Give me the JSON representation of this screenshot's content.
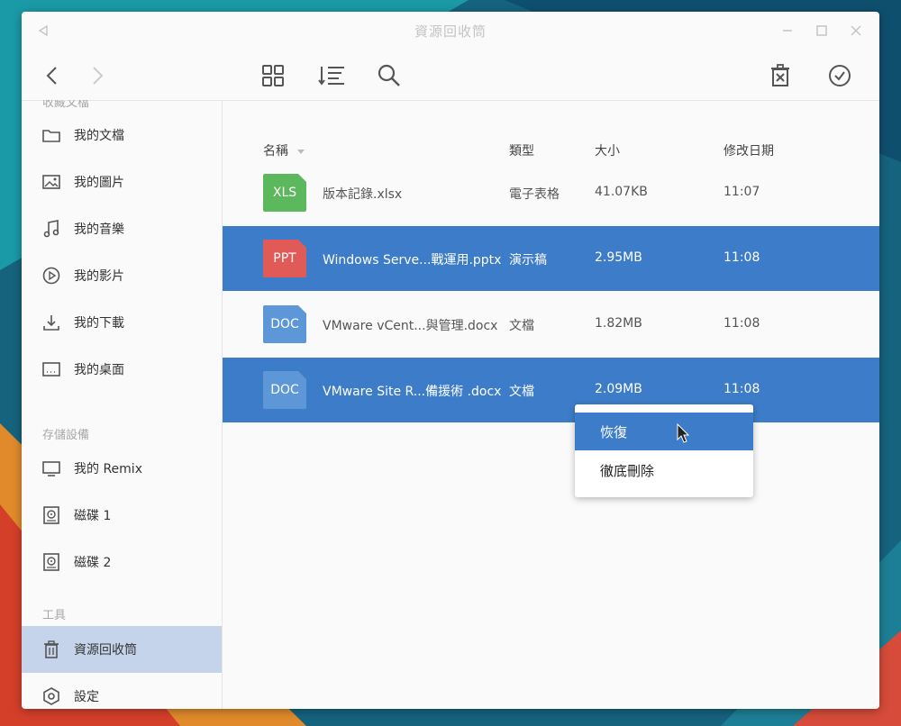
{
  "window": {
    "title": "資源回收筒"
  },
  "sidebar": {
    "partial_section": "收藏文檔",
    "items_favorites": [
      {
        "label": "我的文檔",
        "icon": "folder-icon"
      },
      {
        "label": "我的圖片",
        "icon": "image-icon"
      },
      {
        "label": "我的音樂",
        "icon": "music-icon"
      },
      {
        "label": "我的影片",
        "icon": "play-icon"
      },
      {
        "label": "我的下載",
        "icon": "download-icon"
      },
      {
        "label": "我的桌面",
        "icon": "desktop-icon"
      }
    ],
    "storage_section": "存儲設備",
    "items_storage": [
      {
        "label": "我的 Remix",
        "icon": "monitor-icon"
      },
      {
        "label": "磁碟 1",
        "icon": "disk-icon"
      },
      {
        "label": "磁碟 2",
        "icon": "disk-icon"
      }
    ],
    "tools_section": "工具",
    "items_tools": [
      {
        "label": "資源回收筒",
        "icon": "trash-icon",
        "active": true
      },
      {
        "label": "設定",
        "icon": "settings-icon"
      }
    ]
  },
  "table": {
    "headers": {
      "name": "名稱",
      "type": "類型",
      "size": "大小",
      "modified": "修改日期"
    },
    "rows": [
      {
        "badge": "XLS",
        "badge_color": "#5cb85c",
        "name": "版本記錄.xlsx",
        "type": "電子表格",
        "size": "41.07KB",
        "modified": "11:07",
        "selected": false
      },
      {
        "badge": "PPT",
        "badge_color": "#e05b58",
        "name": "Windows Serve...戰運用.pptx",
        "type": "演示稿",
        "size": "2.95MB",
        "modified": "11:08",
        "selected": true
      },
      {
        "badge": "DOC",
        "badge_color": "#5d97d8",
        "name": "VMware vCent...與管理.docx",
        "type": "文檔",
        "size": "1.82MB",
        "modified": "11:08",
        "selected": false
      },
      {
        "badge": "DOC",
        "badge_color": "#5d97d8",
        "name": "VMware Site R...備援術 .docx",
        "type": "文檔",
        "size": "2.09MB",
        "modified": "11:08",
        "selected": true
      }
    ]
  },
  "context_menu": {
    "restore": "恢復",
    "delete_permanently": "徹底刪除"
  },
  "colors": {
    "accent": "#3d7cc9",
    "active_sidebar": "#c5d4ea"
  }
}
